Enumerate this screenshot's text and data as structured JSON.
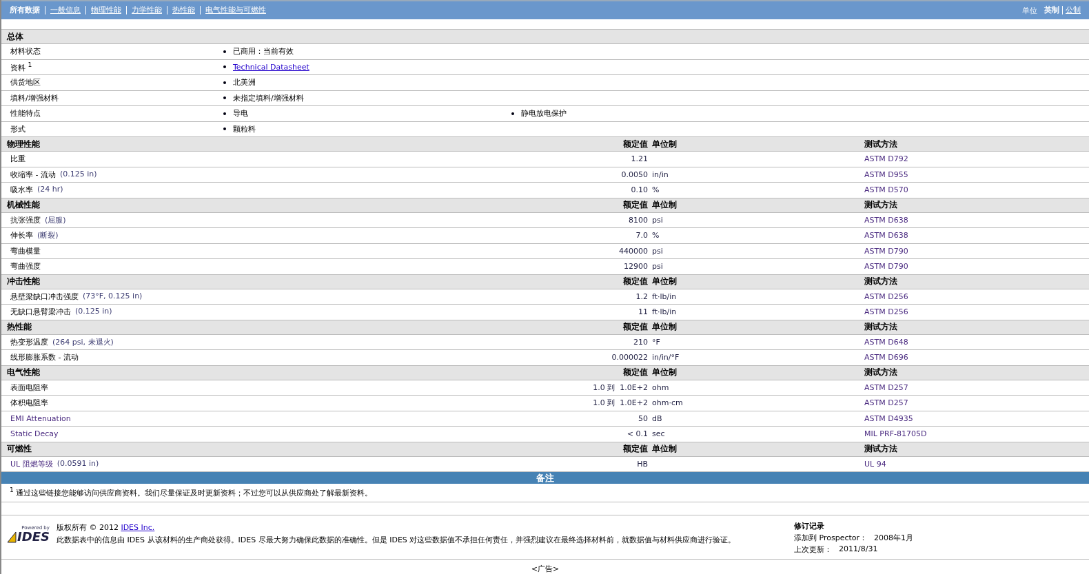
{
  "nav": {
    "tabs": [
      {
        "label": "所有数据",
        "selected": true
      },
      {
        "label": "一般信息",
        "selected": false
      },
      {
        "label": "物理性能",
        "selected": false
      },
      {
        "label": "力学性能",
        "selected": false
      },
      {
        "label": "热性能",
        "selected": false
      },
      {
        "label": "电气性能与可燃性",
        "selected": false
      }
    ],
    "unit_label": "单位",
    "units": [
      {
        "label": "英制",
        "selected": true
      },
      {
        "label": "公制",
        "selected": false
      }
    ]
  },
  "general": {
    "title": "总体",
    "rows": [
      {
        "label": "材料状态",
        "values": [
          {
            "text": "已商用：当前有效",
            "kind": "text"
          }
        ]
      },
      {
        "label": "资料 $^{1}$",
        "values": [
          {
            "text": "Technical Datasheet",
            "kind": "link"
          }
        ]
      },
      {
        "label": "供货地区",
        "values": [
          {
            "text": "北美洲",
            "kind": "text"
          }
        ]
      },
      {
        "label": "填料/增强材料",
        "values": [
          {
            "text": "未指定填料/增强材料",
            "kind": "text"
          }
        ]
      },
      {
        "label": "性能特点",
        "values": [
          {
            "text": "导电",
            "kind": "text"
          },
          {
            "text": "静电放电保护",
            "kind": "text"
          }
        ]
      },
      {
        "label": "形式",
        "values": [
          {
            "text": "颗粒料",
            "kind": "text"
          }
        ]
      }
    ]
  },
  "sections": [
    {
      "title": "物理性能",
      "columns": [
        "额定值",
        "单位制",
        "测试方法"
      ],
      "rows": [
        {
          "name": "比重",
          "linked": false,
          "value": "1.21",
          "method": "ASTM D792"
        },
        {
          "name": "收缩率 - 流动",
          "linked": false,
          "condition": "(0.125 in)",
          "value": "0.0050",
          "unit": "in/in",
          "method": "ASTM D955"
        },
        {
          "name": "吸水率",
          "linked": false,
          "condition": "(24 hr)",
          "value": "0.10",
          "unit": "%",
          "method": "ASTM D570"
        }
      ]
    },
    {
      "title": "机械性能",
      "columns": [
        "额定值",
        "单位制",
        "测试方法"
      ],
      "rows": [
        {
          "name": "抗张强度",
          "linked": false,
          "condition": "(屈服)",
          "value": "8100",
          "unit": "psi",
          "method": "ASTM D638"
        },
        {
          "name": "伸长率",
          "linked": false,
          "condition": "(断裂)",
          "value": "7.0",
          "unit": "%",
          "method": "ASTM D638"
        },
        {
          "name": "弯曲模量",
          "linked": false,
          "value": "440000",
          "unit": "psi",
          "method": "ASTM D790"
        },
        {
          "name": "弯曲强度",
          "linked": false,
          "value": "12900",
          "unit": "psi",
          "method": "ASTM D790"
        }
      ]
    },
    {
      "title": "冲击性能",
      "columns": [
        "额定值",
        "单位制",
        "测试方法"
      ],
      "rows": [
        {
          "name": "悬壁梁缺口冲击强度",
          "linked": false,
          "condition": "(73°F, 0.125 in)",
          "value": "1.2",
          "unit": "ft·lb/in",
          "method": "ASTM D256"
        },
        {
          "name": "无缺口悬臂梁冲击",
          "linked": false,
          "condition": "(0.125 in)",
          "value": "11",
          "unit": "ft·lb/in",
          "method": "ASTM D256"
        }
      ]
    },
    {
      "title": "热性能",
      "columns": [
        "额定值",
        "单位制",
        "测试方法"
      ],
      "rows": [
        {
          "name": "热变形温度",
          "linked": false,
          "condition": "(264 psi, 未退火)",
          "value": "210",
          "unit": "°F",
          "method": "ASTM D648"
        },
        {
          "name": "线形膨胀系数 - 流动",
          "linked": false,
          "value": "0.000022",
          "unit": "in/in/°F",
          "method": "ASTM D696"
        }
      ]
    },
    {
      "title": "电气性能",
      "columns": [
        "额定值",
        "单位制",
        "测试方法"
      ],
      "rows": [
        {
          "name": "表面电阻率",
          "linked": false,
          "value": "1.0 到  1.0E+2",
          "unit": "ohm",
          "method": "ASTM D257"
        },
        {
          "name": "体积电阻率",
          "linked": false,
          "value": "1.0 到  1.0E+2",
          "unit": "ohm·cm",
          "method": "ASTM D257"
        },
        {
          "name": "EMI Attenuation",
          "linked": true,
          "value": "50",
          "unit": "dB",
          "method": "ASTM D4935"
        },
        {
          "name": "Static Decay",
          "linked": true,
          "value": "< 0.1",
          "unit": "sec",
          "method": "MIL PRF-81705D"
        }
      ]
    },
    {
      "title": "可燃性",
      "columns": [
        "额定值",
        "单位制",
        "测试方法"
      ],
      "rows": [
        {
          "name": "UL 阻燃等级",
          "linked": true,
          "condition": "(0.0591 in)",
          "value": "HB",
          "method": "UL 94"
        }
      ]
    }
  ],
  "notes": {
    "title": "备注",
    "items": [
      "$^{1}$ 通过这些链接您能够访问供应商资料。我们尽量保证及时更新资料；不过您可以从供应商处了解最新资料。"
    ]
  },
  "footer": {
    "logo_small": "Powered by",
    "logo_big": "IDES",
    "copyright": "版权所有 © 2012",
    "copyright_link": "IDES Inc.",
    "disclaimer": "此数据表中的信息由 IDES 从该材料的生产商处获得。IDES 尽最大努力确保此数据的准确性。但是 IDES 对这些数据值不承担任何责任，并强烈建议在最终选择材料前，就数据值与材料供应商进行验证。",
    "revision": {
      "title": "修订记录",
      "lines": [
        {
          "label": "添加到 Prospector：",
          "value": "2008年1月"
        },
        {
          "label": "上次更新：",
          "value": "2011/8/31"
        }
      ]
    }
  },
  "ad": "<广告>"
}
